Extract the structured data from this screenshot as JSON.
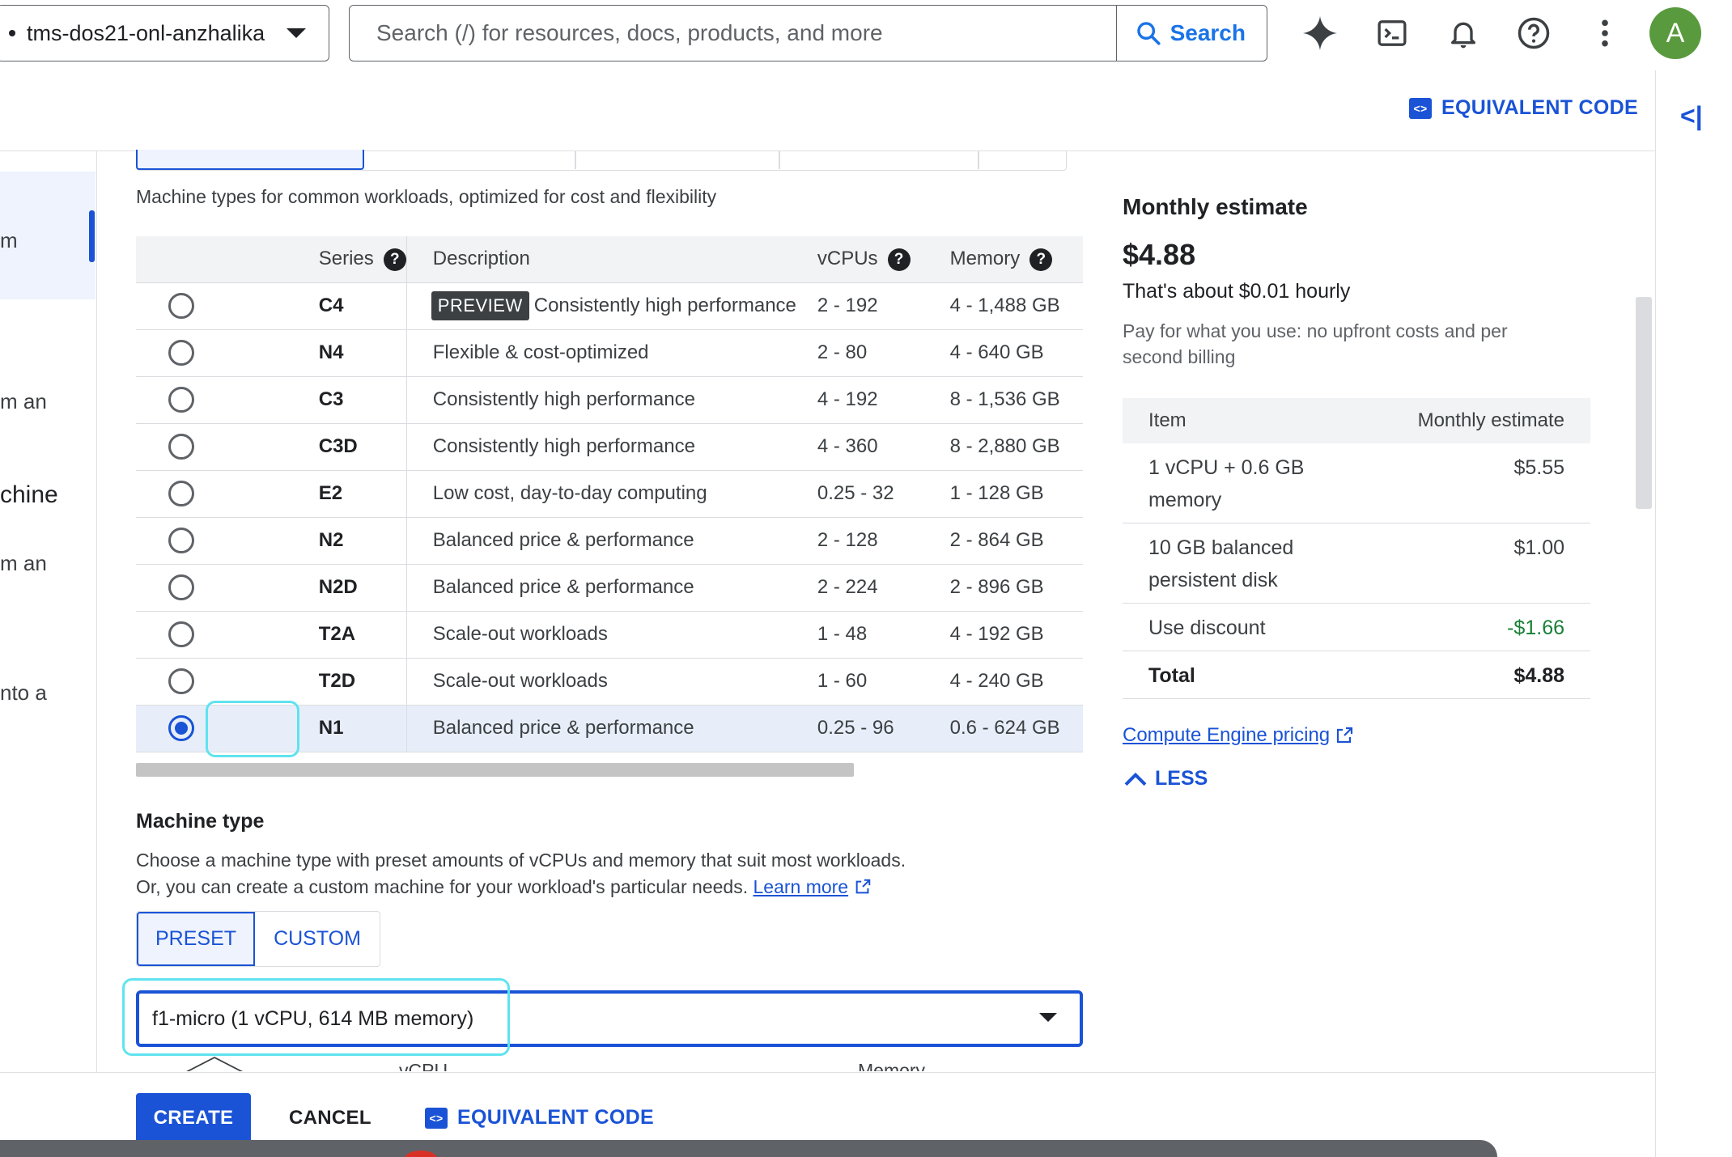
{
  "topbar": {
    "project_name": "tms-dos21-onl-anzhalika",
    "search_placeholder": "Search (/) for resources, docs, products, and more",
    "search_button": "Search",
    "avatar_letter": "A"
  },
  "header": {
    "equivalent_code": "EQUIVALENT CODE",
    "collapse": "<|"
  },
  "leftnav": {
    "fragments": [
      "m",
      "m an",
      "chine",
      "m an",
      "nto a"
    ]
  },
  "series": {
    "subtitle": "Machine types for common workloads, optimized for cost and flexibility",
    "columns": {
      "series": "Series",
      "description": "Description",
      "vcpus": "vCPUs",
      "memory": "Memory"
    },
    "preview_badge": "PREVIEW",
    "rows": [
      {
        "name": "C4",
        "desc": "Consistently high performance",
        "vcpus": "2 - 192",
        "memory": "4 - 1,488 GB"
      },
      {
        "name": "N4",
        "desc": "Flexible & cost-optimized",
        "vcpus": "2 - 80",
        "memory": "4 - 640 GB"
      },
      {
        "name": "C3",
        "desc": "Consistently high performance",
        "vcpus": "4 - 192",
        "memory": "8 - 1,536 GB"
      },
      {
        "name": "C3D",
        "desc": "Consistently high performance",
        "vcpus": "4 - 360",
        "memory": "8 - 2,880 GB"
      },
      {
        "name": "E2",
        "desc": "Low cost, day-to-day computing",
        "vcpus": "0.25 - 32",
        "memory": "1 - 128 GB"
      },
      {
        "name": "N2",
        "desc": "Balanced price & performance",
        "vcpus": "2 - 128",
        "memory": "2 - 864 GB"
      },
      {
        "name": "N2D",
        "desc": "Balanced price & performance",
        "vcpus": "2 - 224",
        "memory": "2 - 896 GB"
      },
      {
        "name": "T2A",
        "desc": "Scale-out workloads",
        "vcpus": "1 - 48",
        "memory": "4 - 192 GB"
      },
      {
        "name": "T2D",
        "desc": "Scale-out workloads",
        "vcpus": "1 - 60",
        "memory": "4 - 240 GB"
      },
      {
        "name": "N1",
        "desc": "Balanced price & performance",
        "vcpus": "0.25 - 96",
        "memory": "0.6 - 624 GB"
      }
    ],
    "selected": "N1"
  },
  "machine_type": {
    "title": "Machine type",
    "desc_line1": "Choose a machine type with preset amounts of vCPUs and memory that suit most workloads.",
    "desc_line2": "Or, you can create a custom machine for your workload's particular needs.",
    "learn_more": "Learn more",
    "preset": "PRESET",
    "custom": "CUSTOM",
    "selected_value": "f1-micro (1 vCPU, 614 MB memory)",
    "cut_vcpu": "vCPU",
    "cut_memory": "Memory"
  },
  "estimate": {
    "title": "Monthly estimate",
    "price": "$4.88",
    "hourly": "That's about $0.01 hourly",
    "pay_note": "Pay for what you use: no upfront costs and per second billing",
    "col_item": "Item",
    "col_estimate": "Monthly estimate",
    "rows": [
      {
        "item": "1 vCPU + 0.6 GB memory",
        "value": "$5.55"
      },
      {
        "item": "10 GB balanced persistent disk",
        "value": "$1.00"
      },
      {
        "item": "Use discount",
        "value": "-$1.66"
      },
      {
        "item": "Total",
        "value": "$4.88"
      }
    ],
    "pricing_link": "Compute Engine pricing",
    "less": "LESS"
  },
  "footer": {
    "create": "CREATE",
    "cancel": "CANCEL",
    "equivalent_code": "EQUIVALENT CODE"
  }
}
